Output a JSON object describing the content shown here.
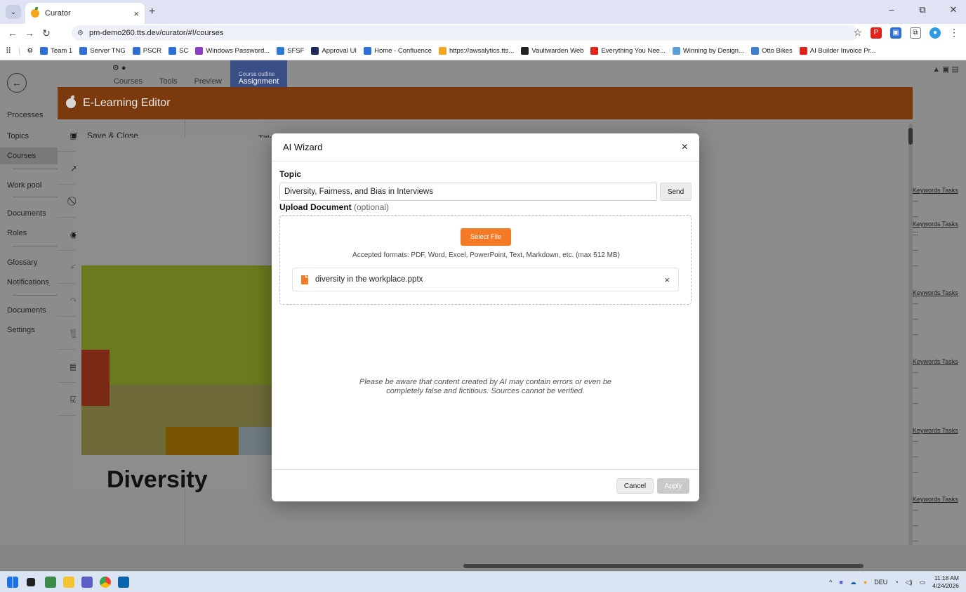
{
  "browser": {
    "tab_title": "Curator",
    "tab_close": "×",
    "new_tab": "+",
    "url": "pm-demo260.tts.dev/curator/#!/courses",
    "window_controls": {
      "minimize": "–",
      "restore": "⧉",
      "close": "✕"
    },
    "bookmarks": [
      {
        "label": "Team 1",
        "icon": "confluence-icon",
        "color": "#2e6fd6"
      },
      {
        "label": "Server TNG",
        "icon": "confluence-icon",
        "color": "#2e6fd6"
      },
      {
        "label": "PSCR",
        "icon": "confluence-icon",
        "color": "#2e6fd6"
      },
      {
        "label": "SC",
        "icon": "confluence-icon",
        "color": "#2e6fd6"
      },
      {
        "label": "Windows Password...",
        "icon": "powerapps-icon",
        "color": "#8a3fc2"
      },
      {
        "label": "SFSF",
        "icon": "sap-icon",
        "color": "#2a7bd6"
      },
      {
        "label": "Approval UI",
        "icon": "tts-icon",
        "color": "#1d2a5a"
      },
      {
        "label": "Home - Confluence",
        "icon": "confluence-icon",
        "color": "#2e6fd6"
      },
      {
        "label": "https://awsalytics.tts...",
        "icon": "curator-icon",
        "color": "#f4a51c"
      },
      {
        "label": "Vaultwarden Web",
        "icon": "vaultwarden-icon",
        "color": "#222222"
      },
      {
        "label": "Everything You Nee...",
        "icon": "asterisk-icon",
        "color": "#e2231a"
      },
      {
        "label": "Winning by Design...",
        "icon": "wbd-icon",
        "color": "#5aa0d8"
      },
      {
        "label": "Otto Bikes",
        "icon": "powerbi-icon",
        "color": "#3a7fd0"
      },
      {
        "label": "AI Builder Invoice Pr...",
        "icon": "youtube-icon",
        "color": "#e2231a"
      }
    ]
  },
  "app": {
    "top_tabs": [
      {
        "label": "Courses",
        "sup": ""
      },
      {
        "label": "Tools",
        "sup": ""
      },
      {
        "label": "Preview",
        "sup": ""
      },
      {
        "label": "Assignment",
        "sup": "Course outline"
      }
    ],
    "nav": [
      {
        "label": "Processes",
        "active": false
      },
      {
        "label": "Topics",
        "active": false
      },
      {
        "label": "Courses",
        "active": true
      },
      {
        "label": "Work pool",
        "active": false
      },
      {
        "label": "Documents",
        "active": false
      },
      {
        "label": "Roles",
        "active": false
      },
      {
        "label": "Glossary",
        "active": false
      },
      {
        "label": "Notifications",
        "active": false
      },
      {
        "label": "Documents",
        "active": false
      },
      {
        "label": "Settings",
        "active": false
      }
    ],
    "editor_title": "E-Learning Editor",
    "editor_actions": [
      {
        "label": "Save & Close",
        "icon": "save-icon",
        "enabled": true
      },
      {
        "label": "Open In Tab",
        "icon": "open-external-icon",
        "enabled": true
      },
      {
        "label": "Discard Changes",
        "icon": "block-icon",
        "enabled": true
      },
      {
        "label": "Show Preview",
        "icon": "eye-icon",
        "enabled": true
      },
      {
        "label": "Undo",
        "icon": "undo-icon",
        "enabled": false
      },
      {
        "label": "Redo",
        "icon": "redo-icon",
        "enabled": false
      },
      {
        "label": "Delete",
        "icon": "trash-icon",
        "enabled": false
      },
      {
        "label": "AI Wizard",
        "icon": "wizard-icon",
        "enabled": true
      },
      {
        "label": "Fixed sidebar",
        "icon": "checkbox-checked-icon",
        "enabled": true
      }
    ],
    "title_label": "Title",
    "slide_heading": "Diversity",
    "right_panel": {
      "keywords_label": "Keywords",
      "tasks_label": "Tasks",
      "dash": "---"
    }
  },
  "modal": {
    "title": "AI Wizard",
    "close": "×",
    "topic_label": "Topic",
    "topic_value": "Diversity, Fairness, and Bias in Interviews",
    "send_label": "Send",
    "upload_label": "Upload Document",
    "upload_optional": "(optional)",
    "select_file_label": "Select File",
    "accepted_formats": "Accepted formats: PDF, Word, Excel, PowerPoint, Text, Markdown, etc. (max 512 MB)",
    "file_name": "diversity in the workplace.pptx",
    "file_remove": "×",
    "disclaimer_line1": "Please be aware that content created by AI may contain errors or even be",
    "disclaimer_line2": "completely false and fictitious. Sources cannot be verified.",
    "cancel_label": "Cancel",
    "apply_label": "Apply",
    "accent_color": "#f47a26"
  },
  "taskbar": {
    "language": "DEU",
    "time": "11:18 AM",
    "date": "4/24/2026"
  }
}
